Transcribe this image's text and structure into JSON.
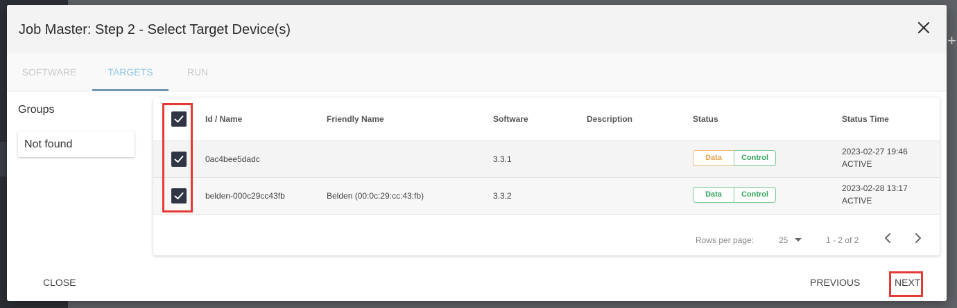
{
  "dialog": {
    "title": "Job Master: Step 2 - Select Target Device(s)"
  },
  "tabs": [
    {
      "label": "SOFTWARE",
      "active": false
    },
    {
      "label": "TARGETS",
      "active": true
    },
    {
      "label": "RUN",
      "active": false
    }
  ],
  "groups": {
    "label": "Groups",
    "items": [
      "Not found"
    ]
  },
  "table": {
    "columns": [
      "Id / Name",
      "Friendly Name",
      "Software",
      "Description",
      "Status",
      "Status Time"
    ],
    "rows": [
      {
        "checked": true,
        "id_name": "0ac4bee5dadc",
        "friendly_name": "",
        "software": "3.3.1",
        "description": "",
        "status_data": "Data",
        "status_control": "Control",
        "status_time": "2023-02-27 19:46",
        "status_state": "ACTIVE"
      },
      {
        "checked": true,
        "id_name": "belden-000c29cc43fb",
        "friendly_name": "Belden (00:0c:29:cc:43:fb)",
        "software": "3.3.2",
        "description": "",
        "status_data": "Data",
        "status_control": "Control",
        "status_time": "2023-02-28 13:17",
        "status_state": "ACTIVE"
      }
    ],
    "footer": {
      "rows_per_page_label": "Rows per page:",
      "rows_per_page_value": "25",
      "range": "1 - 2 of 2"
    }
  },
  "footer": {
    "close_label": "CLOSE",
    "previous_label": "PREVIOUS",
    "next_label": "NEXT"
  },
  "colors": {
    "status_warning": "#e8a14b",
    "status_ok": "#35a55d",
    "checkbox": "#2f3542",
    "active_tab_text": "#8dc6e6",
    "active_tab_underline": "#4f7d9c",
    "highlight": "#e53935"
  },
  "icons": [
    "close-icon",
    "check-icon",
    "dropdown-arrow-icon",
    "chevron-left-icon",
    "chevron-right-icon"
  ]
}
